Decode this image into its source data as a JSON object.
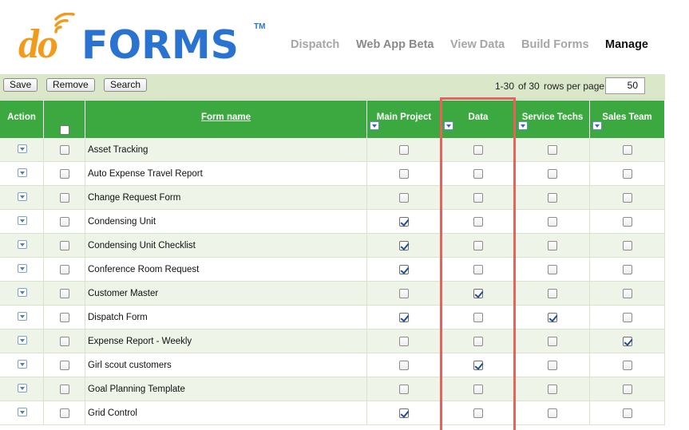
{
  "header": {
    "logo": {
      "do": "do",
      "forms": "FORMS",
      "tm": "TM"
    },
    "nav": [
      {
        "label": "Dispatch",
        "state": "inactive"
      },
      {
        "label": "Web App Beta",
        "state": "mid"
      },
      {
        "label": "View Data",
        "state": "inactive"
      },
      {
        "label": "Build Forms",
        "state": "inactive"
      },
      {
        "label": "Manage",
        "state": "active"
      }
    ]
  },
  "toolbar": {
    "save_label": "Save",
    "remove_label": "Remove",
    "search_label": "Search",
    "range": "1-30",
    "of_total": "of 30",
    "rows_per_page_label": "rows per page:",
    "rows_per_page_value": "50"
  },
  "table": {
    "headers": {
      "action": "Action",
      "form_name": "Form name",
      "main_project": "Main Project",
      "data": "Data",
      "service_techs": "Service Techs",
      "sales_team": "Sales Team"
    },
    "rows": [
      {
        "name": "Asset Tracking",
        "main_project": false,
        "data": false,
        "service_techs": false,
        "sales_team": false
      },
      {
        "name": "Auto Expense Travel Report",
        "main_project": false,
        "data": false,
        "service_techs": false,
        "sales_team": false
      },
      {
        "name": "Change Request Form",
        "main_project": false,
        "data": false,
        "service_techs": false,
        "sales_team": false
      },
      {
        "name": "Condensing Unit",
        "main_project": true,
        "data": false,
        "service_techs": false,
        "sales_team": false
      },
      {
        "name": "Condensing Unit Checklist",
        "main_project": true,
        "data": false,
        "service_techs": false,
        "sales_team": false
      },
      {
        "name": "Conference Room Request",
        "main_project": true,
        "data": false,
        "service_techs": false,
        "sales_team": false
      },
      {
        "name": "Customer Master",
        "main_project": false,
        "data": true,
        "service_techs": false,
        "sales_team": false
      },
      {
        "name": "Dispatch Form",
        "main_project": true,
        "data": false,
        "service_techs": true,
        "sales_team": false
      },
      {
        "name": "Expense Report - Weekly",
        "main_project": false,
        "data": false,
        "service_techs": false,
        "sales_team": true
      },
      {
        "name": "Girl scout customers",
        "main_project": false,
        "data": true,
        "service_techs": false,
        "sales_team": false
      },
      {
        "name": "Goal Planning Template",
        "main_project": false,
        "data": false,
        "service_techs": false,
        "sales_team": false
      },
      {
        "name": "Grid Control",
        "main_project": true,
        "data": false,
        "service_techs": false,
        "sales_team": false
      }
    ]
  },
  "colors": {
    "header_green": "#3ca940",
    "toolbar_green": "#dae8c9",
    "highlight_red": "#e8625a",
    "logo_orange": "#f29a1b",
    "logo_blue": "#2a73d0"
  }
}
